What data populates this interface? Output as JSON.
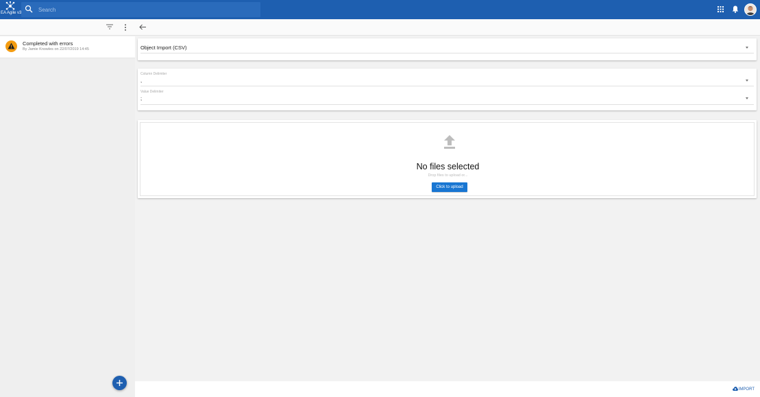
{
  "header": {
    "logo_text": "EA Agile v3",
    "search_placeholder": "Search"
  },
  "sidebar": {
    "jobs": [
      {
        "status": "Completed with errors",
        "meta": "By Jamie Knowles on 22/07/2019 14:45",
        "status_color": "#f39c12"
      }
    ]
  },
  "main": {
    "import_type": {
      "value": "Object Import (CSV)"
    },
    "column_delimiter": {
      "label": "Column Delimiter",
      "value": ","
    },
    "value_delimiter": {
      "label": "Value Delimiter",
      "value": ";"
    },
    "upload": {
      "title": "No files selected",
      "hint": "Drop files to upload or...",
      "button_label": "Click to upload"
    }
  },
  "footer": {
    "import_label": "IMPORT"
  },
  "colors": {
    "brand": "#1e5fb0",
    "button": "#1976d2",
    "warning": "#f39c12"
  }
}
